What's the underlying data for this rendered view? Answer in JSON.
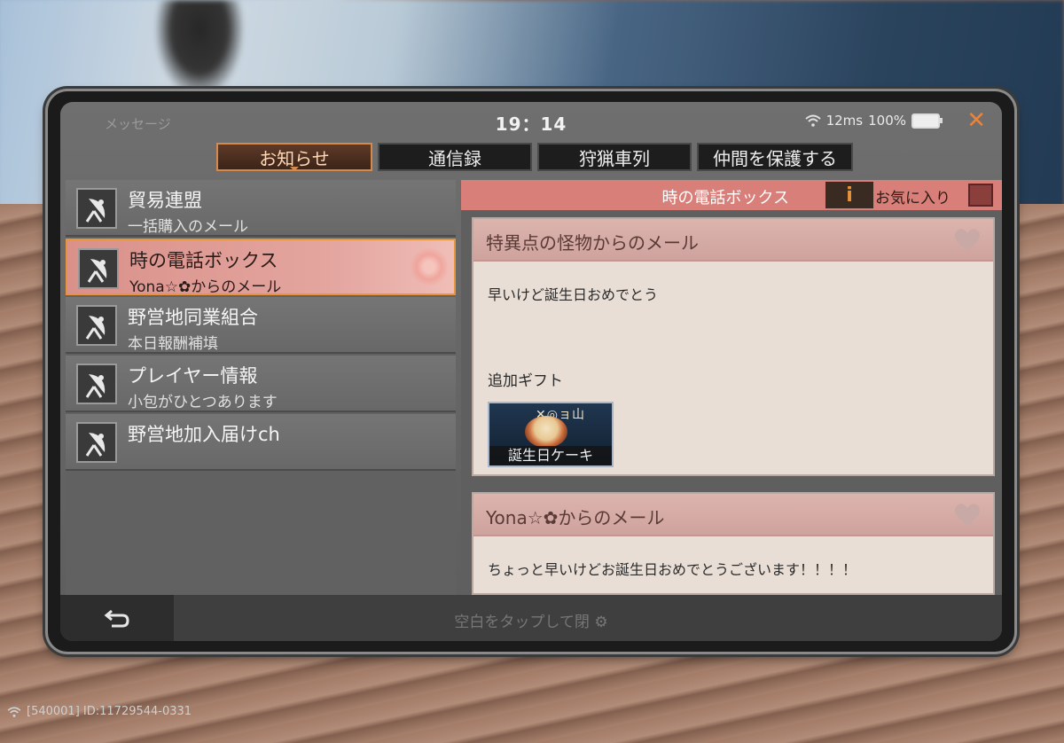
{
  "app_title": "メッセージ",
  "status": {
    "time": "19：14",
    "ping": "12ms",
    "battery": "100%"
  },
  "tabs": [
    {
      "label": "お知らせ",
      "active": true
    },
    {
      "label": "通信録",
      "active": false
    },
    {
      "label": "狩猟車列",
      "active": false
    },
    {
      "label": "仲間を保護する",
      "active": false
    }
  ],
  "list": [
    {
      "title": "貿易連盟",
      "subtitle": "一括購入のメール"
    },
    {
      "title": "時の電話ボックス",
      "subtitle": "Yona☆✿からのメール"
    },
    {
      "title": "野営地同業組合",
      "subtitle": "本日報酬補填"
    },
    {
      "title": "プレイヤー情報",
      "subtitle": "小包がひとつあります"
    },
    {
      "title": "野営地加入届けch",
      "subtitle": ""
    }
  ],
  "detail": {
    "header_title": "時の電話ボックス",
    "favorite_label": "お気に入り",
    "mails": [
      {
        "title": "特異点の怪物からのメール",
        "body": "早いけど誕生日おめでとう",
        "gift_label": "追加ギフト",
        "gift_name": "誕生日ケーキ",
        "gift_deco": "✕◎ョ山"
      },
      {
        "title": "Yona☆✿からのメール",
        "body": "ちょっと早いけどお誕生日おめでとうございます！！！！"
      }
    ]
  },
  "bottom": {
    "tap_close": "空白をタップして閉 ⚙"
  },
  "footer": {
    "id_text": "[540001] ID:11729544-0331"
  },
  "colors": {
    "accent": "#e8843a",
    "selected_row": "#e4a6a0",
    "detail_header": "#d97f79"
  }
}
